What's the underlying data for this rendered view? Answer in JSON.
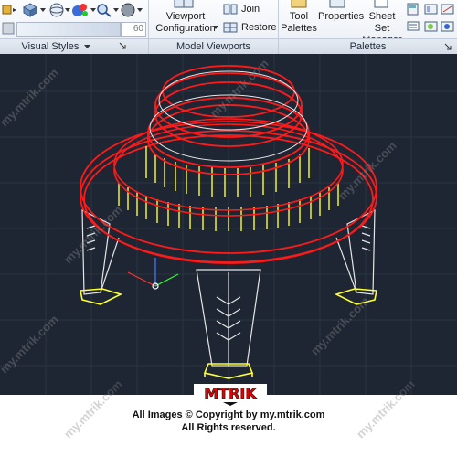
{
  "ribbon": {
    "panels": {
      "visual_styles": "Visual Styles",
      "model_viewports": "Model Viewports",
      "palettes": "Palettes"
    },
    "viewport_config": {
      "line1": "Viewport",
      "line2": "Configuration"
    },
    "join_label": "Join",
    "restore_label": "Restore",
    "tool_palettes": {
      "line1": "Tool",
      "line2": "Palettes"
    },
    "properties_label": "Properties",
    "sheet_set_manager": {
      "line1": "Sheet Set",
      "line2": "Manager"
    },
    "opacity_value": "60"
  },
  "watermark": {
    "logo_text": "MTRIK",
    "site_text": "my.mtrik.com",
    "copyright_line1": "All Images © Copyright by my.mtrik.com",
    "copyright_line2": "All Rights reserved."
  },
  "colors": {
    "canvas_bg": "#1e2633",
    "red_geometry": "#ff1a1a",
    "yellow_geometry": "#ffff33",
    "white_geometry": "#e8e8e8"
  },
  "icons": [
    "cube-icon",
    "sphere-icon",
    "gear-icon",
    "viewport-icon",
    "join-icon",
    "restore-icon",
    "tool-palettes-icon",
    "properties-icon",
    "sheet-set-icon"
  ]
}
